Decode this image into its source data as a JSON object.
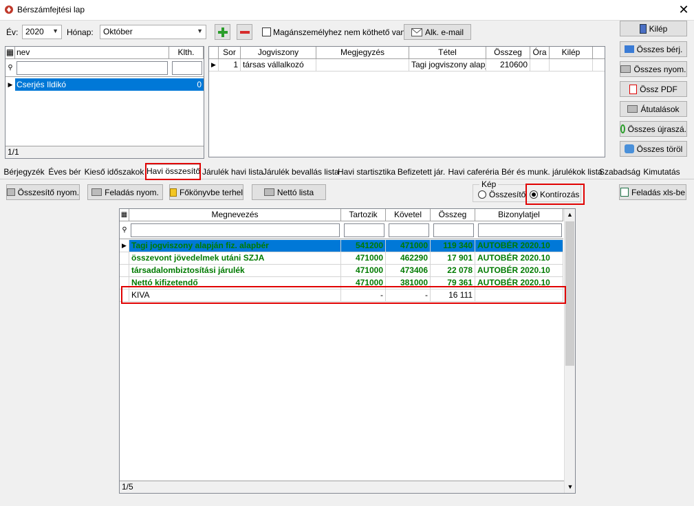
{
  "window": {
    "title": "Bérszámfejtési lap",
    "close_glyph": "✕"
  },
  "toolbar": {
    "ev_label": "Év:",
    "ev_value": "2020",
    "honap_label": "Hónap:",
    "honap_value": "Október",
    "add_icon": "plus-icon",
    "remove_icon": "minus-icon",
    "checkbox_label": "Magánszemélyhez nem köthető van",
    "email_button": "Alk. e-mail"
  },
  "left_grid": {
    "headers": [
      "nev",
      "Klth."
    ],
    "rows": [
      {
        "nev": "Cserjés Ildikó",
        "klth": "0"
      }
    ],
    "footer": "1/1"
  },
  "right_grid": {
    "headers": [
      "Sor",
      "Jogviszony",
      "Megjegyzés",
      "Tétel",
      "Összeg",
      "Óra",
      "Kilép"
    ],
    "rows": [
      {
        "sor": "1",
        "jogviszony": "társas vállalkozó",
        "megjegyzes": "",
        "tetel": "Tagi jogviszony alapján",
        "osszeg": "210600",
        "ora": "",
        "kilep": ""
      }
    ]
  },
  "side_buttons": [
    "Kilép",
    "Összes bérj.",
    "Összes nyom.",
    "Össz PDF",
    "Átutalások",
    "Összes újraszá.",
    "Összes töröl"
  ],
  "tabs": [
    "Bérjegyzék",
    "Éves bér",
    "Kieső időszakok",
    "Havi összesítő",
    "Járulék havi lista",
    "Járulék bevallás lista",
    "Havi startisztika",
    "Befizetett jár.",
    "Havi caferéria",
    "Bér és munk. járulékok lista",
    "Szabadság",
    "Kimutatás"
  ],
  "active_tab": "Havi összesítő",
  "action_buttons": {
    "osszesito_nyom": "Összesítő nyom.",
    "feladas_nyom": "Feladás nyom.",
    "fokonyvbe": "Főkönyvbe terhel",
    "netto_lista": "Nettó lista",
    "feladas_xls": "Feladás xls-be"
  },
  "kep_group": {
    "legend": "Kép",
    "option1": "Összesítő",
    "option2": "Kontírozás",
    "selected": "Kontírozás"
  },
  "main_grid": {
    "headers": [
      "Megnevezés",
      "Tartozik",
      "Követel",
      "Összeg",
      "Bizonylatjel"
    ],
    "rows": [
      {
        "megnevezes": "Tagi jogviszony alapján fiz. alapbér",
        "tartozik": "541200",
        "kovetel": "471000",
        "osszeg": "119 340",
        "bizonylat": "AUTOBÉR 2020.10"
      },
      {
        "megnevezes": "összevont jövedelmek utáni SZJA",
        "tartozik": "471000",
        "kovetel": "462290",
        "osszeg": "17 901",
        "bizonylat": "AUTOBÉR 2020.10"
      },
      {
        "megnevezes": "társadalombiztosítási járulék",
        "tartozik": "471000",
        "kovetel": "473406",
        "osszeg": "22 078",
        "bizonylat": "AUTOBÉR 2020.10"
      },
      {
        "megnevezes": "Nettó kifizetendő",
        "tartozik": "471000",
        "kovetel": "381000",
        "osszeg": "79 361",
        "bizonylat": "AUTOBÉR 2020.10"
      },
      {
        "megnevezes": "KIVA",
        "tartozik": "-",
        "kovetel": "-",
        "osszeg": "16 111",
        "bizonylat": ""
      }
    ],
    "footer": "1/5"
  },
  "colors": {
    "highlight": "#e00000",
    "selection": "#0078d7",
    "green_text": "#007a00"
  }
}
